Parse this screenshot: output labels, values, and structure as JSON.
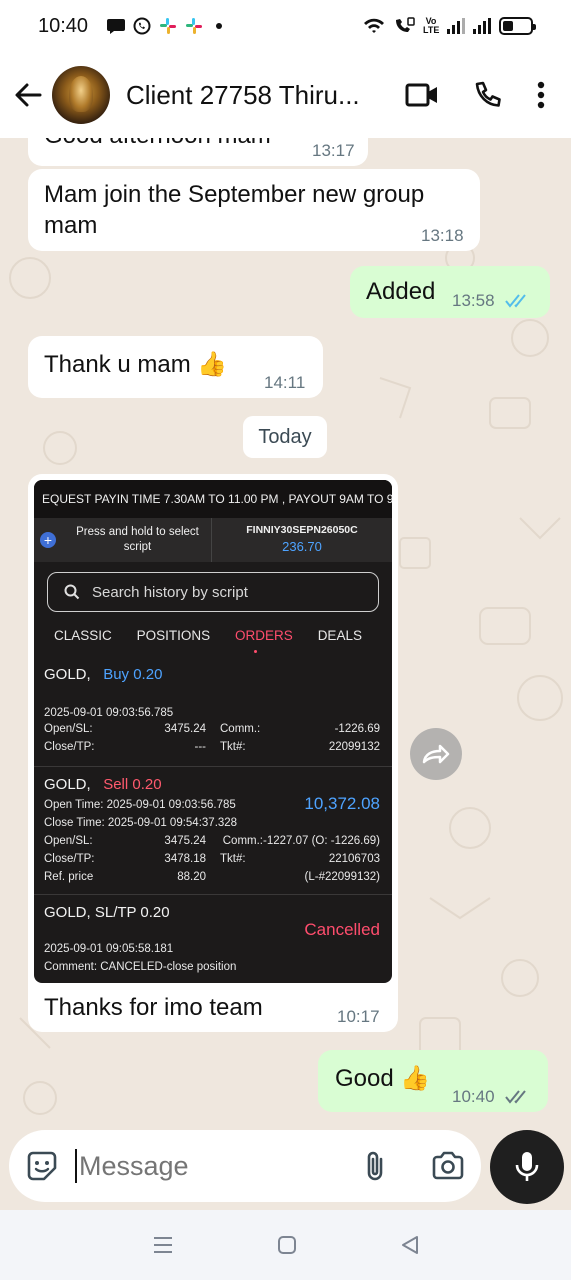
{
  "status_bar": {
    "time": "10:40",
    "volte_text": "Vo LTE"
  },
  "header": {
    "title": "Client 27758 Thiru...",
    "icons": [
      "back-arrow-icon",
      "video-call-icon",
      "phone-icon",
      "more-vert-icon"
    ]
  },
  "messages": [
    {
      "text": "Good afternoon  mam",
      "time": "13:17",
      "dir": "in"
    },
    {
      "text": "Mam join the  September new group mam",
      "time": "13:18",
      "dir": "in"
    },
    {
      "text": "Added",
      "time": "13:58",
      "dir": "out",
      "read": true
    },
    {
      "text": "Thank u mam 👍",
      "time": "14:11",
      "dir": "in"
    },
    {
      "text": "Thanks for imo team",
      "time": "10:17",
      "dir": "in"
    },
    {
      "text": "Good 👍",
      "time": "10:40",
      "dir": "out",
      "read": false
    }
  ],
  "date_chip": "Today",
  "shot": {
    "marquee": "EQUEST PAYIN TIME 7.30AM  TO 11.00 PM , PAYOUT 9AM TO 9",
    "hint": "Press and hold to select script",
    "symbol": "FINNIY30SEPN26050C",
    "symbol_price": "236.70",
    "search_placeholder": "Search history by script",
    "tabs": [
      "CLASSIC",
      "POSITIONS",
      "ORDERS",
      "DEALS"
    ],
    "active_tab": "ORDERS",
    "order1": {
      "sym": "GOLD,",
      "side": "Buy 0.20",
      "time": "2025-09-01 09:03:56.785",
      "open_label": "Open/SL:",
      "open_val": "3475.24",
      "comm_label": "Comm.:",
      "comm_val": "-1226.69",
      "close_label": "Close/TP:",
      "close_val": "---",
      "tkt_label": "Tkt#:",
      "tkt_val": "22099132"
    },
    "order2": {
      "sym": "GOLD,",
      "side": "Sell 0.20",
      "open_time": "Open Time: 2025-09-01 09:03:56.785",
      "close_time": "Close Time: 2025-09-01 09:54:37.328",
      "profit": "10,372.08",
      "open_label": "Open/SL:",
      "open_val": "3475.24",
      "comm_text": "Comm.:-1227.07 (O: -1226.69)",
      "close_label": "Close/TP:",
      "close_val": "3478.18",
      "tkt_label": "Tkt#:",
      "tkt_val": "22106703",
      "ref_label": "Ref. price",
      "ref_val": "88.20",
      "ref_tkt": "(L-#22099132)"
    },
    "order3": {
      "title": "GOLD,  SL/TP 0.20",
      "status": "Cancelled",
      "time": "2025-09-01 09:05:58.181",
      "comment": "Comment: CANCELED-close position"
    }
  },
  "input": {
    "placeholder": "Message"
  },
  "colors": {
    "out_bubble": "#d9fdd3",
    "in_bubble": "#ffffff",
    "read_tick": "#53bdeb",
    "buy": "#4ea3ff",
    "sell": "#ff5a6e"
  }
}
